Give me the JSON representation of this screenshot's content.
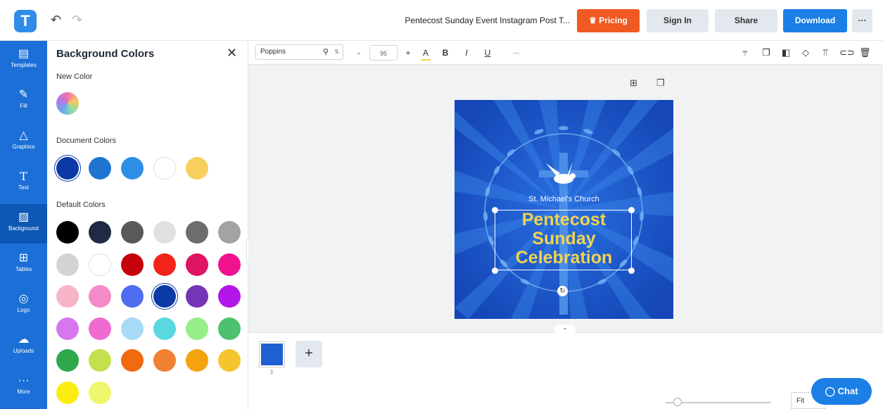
{
  "app": {
    "logo_letter": "T",
    "undo_icon": "undo-icon",
    "redo_icon": "redo-icon"
  },
  "header": {
    "document_title": "Pentecost Sunday Event Instagram Post T...",
    "pricing_label": "Pricing",
    "signin_label": "Sign In",
    "share_label": "Share",
    "download_label": "Download",
    "more_label": "···"
  },
  "nav": {
    "items": [
      {
        "label": "Templates",
        "icon": "templates-icon"
      },
      {
        "label": "Fill",
        "icon": "fill-icon"
      },
      {
        "label": "Graphics",
        "icon": "graphics-icon"
      },
      {
        "label": "Text",
        "icon": "text-icon"
      },
      {
        "label": "Background",
        "icon": "background-icon"
      },
      {
        "label": "Tables",
        "icon": "tables-icon"
      },
      {
        "label": "Logo",
        "icon": "logo-icon"
      },
      {
        "label": "Uploads",
        "icon": "uploads-icon"
      },
      {
        "label": "More",
        "icon": "more-icon"
      }
    ],
    "active": "Background"
  },
  "panel": {
    "title": "Background Colors",
    "new_color_label": "New Color",
    "document_colors_label": "Document Colors",
    "default_colors_label": "Default Colors",
    "document_colors": [
      "#0b3aa6",
      "#1e74d0",
      "#2e8ee6",
      "#ffffff",
      "#f8cf5e"
    ],
    "default_colors": [
      "#000000",
      "#1f2a44",
      "#595959",
      "#e0e0e0",
      "#6d6d6d",
      "#a3a3a3",
      "#d3d3d3",
      "#ffffff",
      "#c5000b",
      "#f2241a",
      "#de1561",
      "#f0128f",
      "#f7b5c8",
      "#f48ac7",
      "#4f6df0",
      "#0b3aa6",
      "#7536b5",
      "#b216e9",
      "#d777ef",
      "#f06bcf",
      "#a6daf7",
      "#5ad8e0",
      "#95ee87",
      "#4dc16e",
      "#2fa84c",
      "#c2e14d",
      "#f16a0f",
      "#f08132",
      "#f4a20d",
      "#f6c42c",
      "#fced11",
      "#eff56d"
    ]
  },
  "toolbar": {
    "font_name": "Poppins",
    "font_size": "95",
    "minus": "-",
    "plus": "+",
    "color_label": "A",
    "bold_label": "B",
    "italic_label": "I",
    "underline_label": "U",
    "more_label": "···"
  },
  "design": {
    "church_name": "St. Michael's Church",
    "headline_line1": "Pentecost",
    "headline_line2": "Sunday",
    "headline_line3": "Celebration",
    "bg_color": "#1f5fd1",
    "text_color": "#f2d34f"
  },
  "pages": {
    "page_number": "1",
    "add_label": "+"
  },
  "zoom": {
    "fit_label": "Fit"
  },
  "chat": {
    "label": "Chat"
  }
}
